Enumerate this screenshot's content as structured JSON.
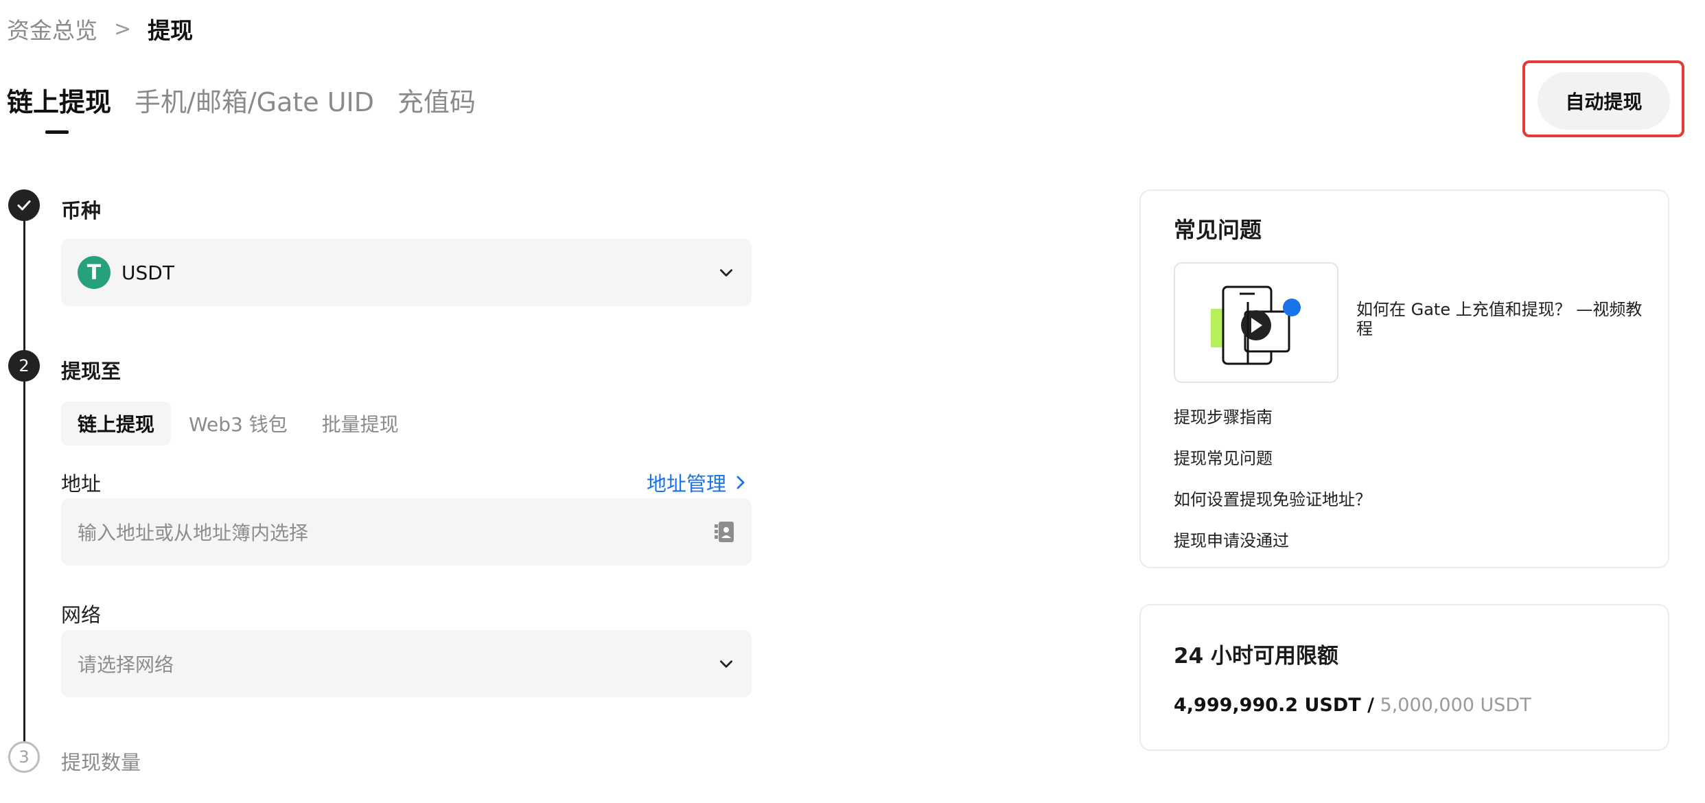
{
  "breadcrumb": {
    "parent": "资金总览",
    "separator": ">",
    "current": "提现"
  },
  "top_tabs": [
    {
      "label": "链上提现"
    },
    {
      "label": "手机/邮箱/Gate UID"
    },
    {
      "label": "充值码"
    }
  ],
  "auto_withdraw_label": "自动提现",
  "steps": {
    "step1": {
      "title": "币种",
      "coin_symbol": "USDT",
      "coin_icon_glyph": "T"
    },
    "step2": {
      "number": "2",
      "title": "提现至",
      "sub_tabs": [
        {
          "label": "链上提现"
        },
        {
          "label": "Web3 钱包"
        },
        {
          "label": "批量提现"
        }
      ],
      "address_label": "地址",
      "address_manage_label": "地址管理",
      "address_placeholder": "输入地址或从地址簿内选择",
      "network_label": "网络",
      "network_placeholder": "请选择网络"
    },
    "step3": {
      "number": "3",
      "title": "提现数量"
    }
  },
  "faq": {
    "title": "常见问题",
    "video_title": "如何在 Gate 上充值和提现？ —视频教程",
    "links": [
      "提现步骤指南",
      "提现常见问题",
      "如何设置提现免验证地址？",
      "提现申请没通过"
    ]
  },
  "quota": {
    "title": "24 小时可用限额",
    "used": "4,999,990.2 USDT /",
    "total": "5,000,000 USDT"
  },
  "colors": {
    "accent_link": "#1a73e8",
    "tether_green": "#26a17b",
    "highlight_red": "#e53935"
  }
}
